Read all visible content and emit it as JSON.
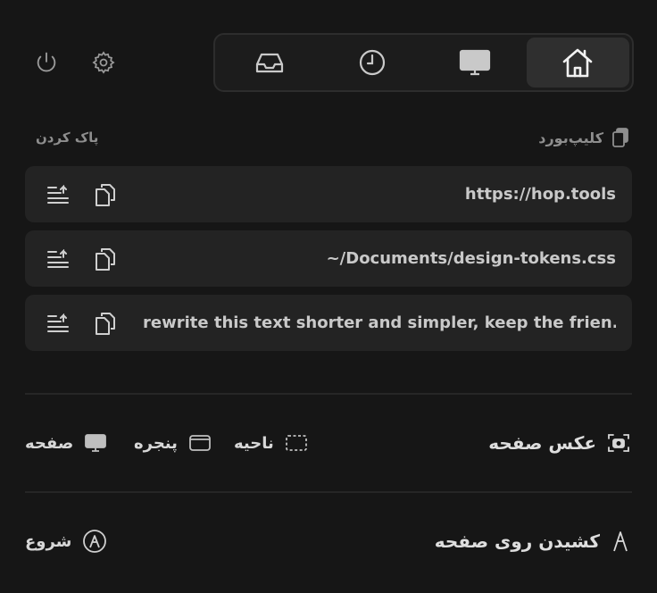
{
  "toolbar": {
    "power_icon": "power-icon",
    "settings_icon": "gear-icon"
  },
  "tabs": [
    {
      "name": "inbox",
      "icon": "inbox-icon",
      "active": false
    },
    {
      "name": "history",
      "icon": "clock-icon",
      "active": false
    },
    {
      "name": "display",
      "icon": "monitor-icon",
      "active": false
    },
    {
      "name": "home",
      "icon": "home-icon",
      "active": true
    }
  ],
  "clipboard": {
    "title": "کلیپ‌بورد",
    "clear_label": "پاک کردن",
    "items": [
      {
        "text": "https://hop.tools"
      },
      {
        "text": "~/Documents/design-tokens.css"
      },
      {
        "text": "rewrite this text shorter and simpler, keep the frien..."
      }
    ]
  },
  "screenshot": {
    "title": "عکس صفحه",
    "options": [
      {
        "label": "ناحیه",
        "icon": "region-select-icon"
      },
      {
        "label": "پنجره",
        "icon": "window-icon"
      },
      {
        "label": "صفحه",
        "icon": "monitor-icon"
      }
    ]
  },
  "draw": {
    "title": "کشیدن روی صفحه",
    "start_label": "شروع"
  },
  "colors": {
    "background": "#161616",
    "row_bg": "#232323",
    "active_tab": "#2f2f2f",
    "text": "#d9d9d9",
    "muted": "#8e8e8e"
  }
}
